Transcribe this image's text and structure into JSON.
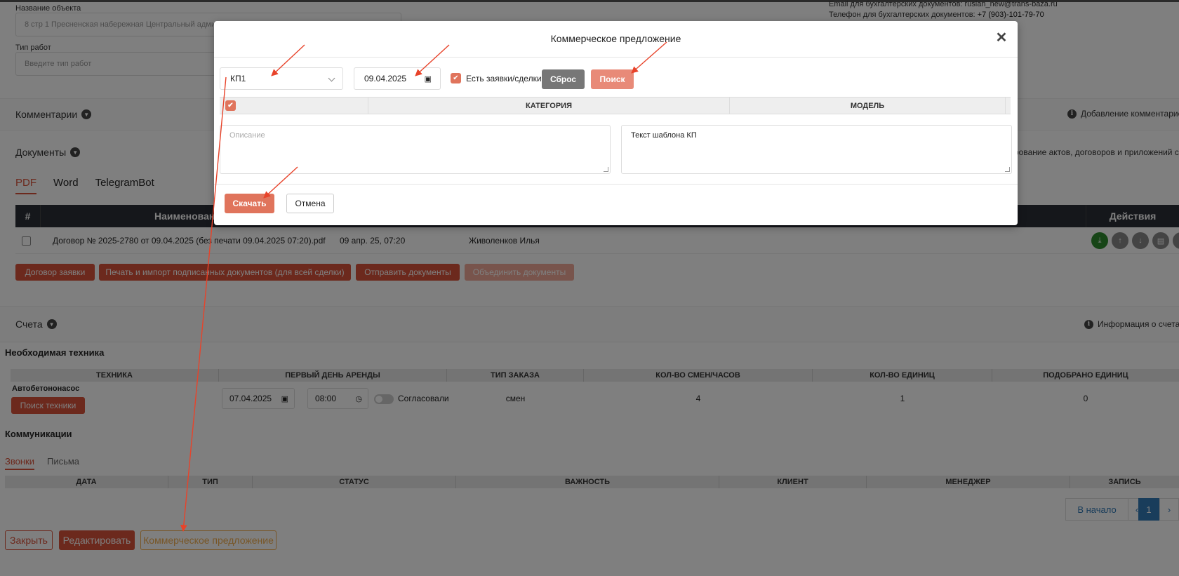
{
  "background": {
    "object_name_label": "Название объекта",
    "object_name_value": "8 стр 1 Пресненская набережная Центральный админ",
    "work_type_label": "Тип работ",
    "work_type_placeholder": "Введите тип работ",
    "email_line": "Email для бухгалтерских документов: ruslan_new@trans-baza.ru",
    "phone_label": "Телефон для бухгалтерских документов:",
    "phone_value": "+7 (903)-101-79-70",
    "comments_title": "Комментарии",
    "comments_hint": "Добавление комментарие",
    "documents_title": "Документы",
    "documents_hint": "рование актов, договоров и приложений с к",
    "doc_tabs": [
      "PDF",
      "Word",
      "TelegramBot"
    ],
    "doc_table": {
      "col_num": "#",
      "col_name": "Наименовани",
      "col_actions": "Действия",
      "row": {
        "name": "Договор № 2025-2780 от 09.04.2025 (без печати 09.04.2025 07:20).pdf",
        "date": "09 апр. 25, 07:20",
        "author": "Живоленков Илья"
      }
    },
    "doc_buttons": [
      "Договор заявки",
      "Печать и импорт подписанных документов (для всей сделки)",
      "Отправить документы",
      "Объединить документы"
    ],
    "accounts_title": "Счета",
    "accounts_hint": "Информация о счетах",
    "tech_title": "Необходимая техника",
    "tech_headers": [
      "ТЕХНИКА",
      "ПЕРВЫЙ ДЕНЬ АРЕНДЫ",
      "ТИП ЗАКАЗА",
      "КОЛ-ВО СМЕН/ЧАСОВ",
      "КОЛ-ВО ЕДИНИЦ",
      "ПОДОБРАНО ЕДИНИЦ"
    ],
    "tech_row": {
      "name": "Автобетононасос",
      "search_btn": "Поиск техники",
      "date": "07.04.2025",
      "time": "08:00",
      "agreed": "Согласовали",
      "order_type": "смен",
      "shifts": "4",
      "units": "1",
      "matched": "0"
    },
    "comm_title": "Коммуникации",
    "comm_tabs": [
      "Звонки",
      "Письма"
    ],
    "comm_headers": [
      "ДАТА",
      "ТИП",
      "СТАТУС",
      "ВАЖНОСТЬ",
      "КЛИЕНТ",
      "МЕНЕДЖЕР",
      "ЗАПИСЬ"
    ],
    "pager": {
      "first": "В начало",
      "prev": "‹",
      "current": "1",
      "next": "›"
    },
    "footer": {
      "close": "Закрыть",
      "edit": "Редактировать",
      "offer": "Коммерческое предложение"
    }
  },
  "modal": {
    "title": "Коммерческое предложение",
    "template_select": "КП1",
    "date_value": "09.04.2025",
    "has_requests_label": "Есть заявки/сделки",
    "reset_btn": "Сброс",
    "search_btn": "Поиск",
    "grid_headers": [
      "КАТЕГОРИЯ",
      "МОДЕЛЬ"
    ],
    "description_placeholder": "Описание",
    "template_text": "Текст шаблона КП",
    "download_btn": "Скачать",
    "cancel_btn": "Отмена"
  },
  "colors": {
    "accent": "#d9533a",
    "accent_light": "#e88a78",
    "annotation_arrow": "#e8432a"
  },
  "icons": [
    "close-icon",
    "calendar-icon",
    "clock-icon",
    "chevron-down-icon",
    "info-icon",
    "download-icon",
    "check-icon"
  ]
}
